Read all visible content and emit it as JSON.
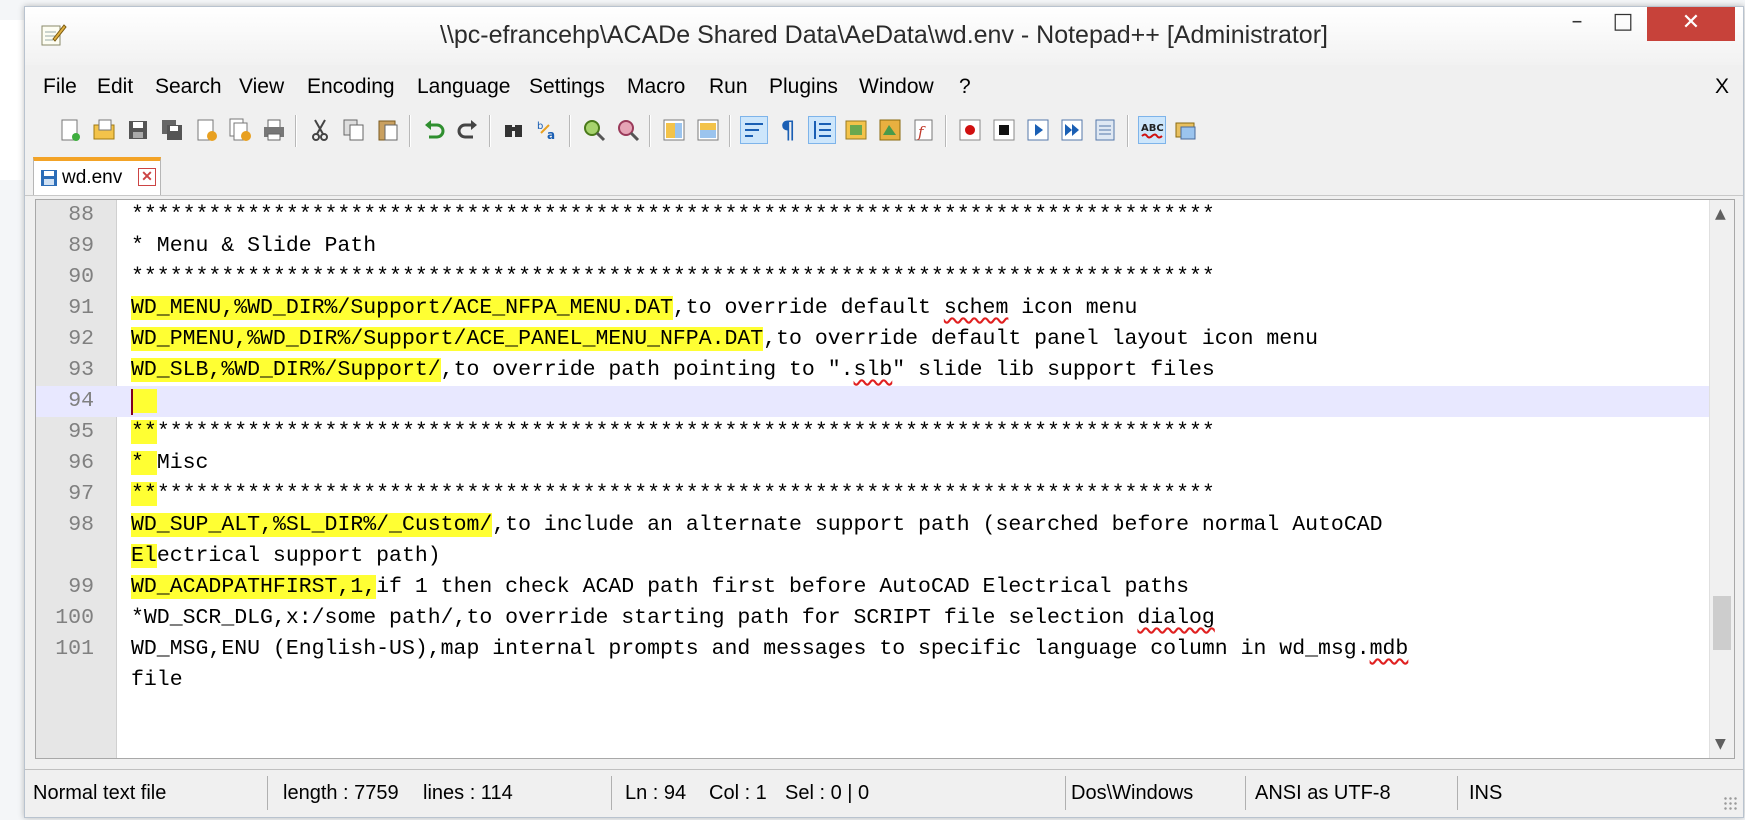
{
  "window": {
    "title": "\\\\pc-efrancehp\\ACADe Shared Data\\AeData\\wd.env - Notepad++ [Administrator]",
    "minimize_glyph": "–",
    "maximize_glyph": "□",
    "close_glyph": "✕",
    "close_color": "#c7423a"
  },
  "menu": {
    "items": [
      "File",
      "Edit",
      "Search",
      "View",
      "Encoding",
      "Language",
      "Settings",
      "Macro",
      "Run",
      "Plugins",
      "Window",
      "?"
    ],
    "close_doc": "X"
  },
  "toolbar": {
    "icons": [
      "new-file-icon",
      "open-file-icon",
      "save-icon",
      "save-all-icon",
      "close-icon",
      "close-all-icon",
      "print-icon",
      "cut-icon",
      "copy-icon",
      "paste-icon",
      "undo-icon",
      "redo-icon",
      "find-icon",
      "replace-icon",
      "zoom-in-icon",
      "zoom-out-icon",
      "sync-vertical-icon",
      "sync-horizontal-icon",
      "word-wrap-icon",
      "show-all-chars-icon",
      "indent-guide-icon",
      "user-lang-icon",
      "doc-map-icon",
      "function-list-icon",
      "record-macro-icon",
      "stop-record-icon",
      "play-macro-icon",
      "run-macro-multiple-icon",
      "save-macro-icon",
      "spell-check-icon",
      "spell-settings-icon"
    ],
    "pilcrow": "¶"
  },
  "tab": {
    "label": "wd.env",
    "close": "✕",
    "accent": "#f3a326"
  },
  "editor": {
    "highlight_color": "#ffff33",
    "current_line": "94",
    "lines": [
      {
        "num": "88",
        "parts": [
          {
            "t": "************************************************************************************"
          }
        ]
      },
      {
        "num": "89",
        "parts": [
          {
            "t": "* Menu & Slide Path"
          }
        ]
      },
      {
        "num": "90",
        "parts": [
          {
            "t": "************************************************************************************"
          }
        ]
      },
      {
        "num": "91",
        "parts": [
          {
            "t": "WD_MENU,",
            "hl": true
          },
          {
            "t": "%WD_DIR%/Support/ACE_NFPA_MENU.DAT",
            "hl": true
          },
          {
            "t": ",to override default "
          },
          {
            "t": "schem",
            "spell": true
          },
          {
            "t": " icon menu"
          }
        ]
      },
      {
        "num": "92",
        "parts": [
          {
            "t": "WD_PMENU,",
            "hl": true
          },
          {
            "t": "%WD_DIR%/Support/ACE_PANEL_MENU_NFPA.DAT",
            "hl": true
          },
          {
            "t": ",to override default panel layout icon menu"
          }
        ]
      },
      {
        "num": "93",
        "parts": [
          {
            "t": "WD_SLB,",
            "hl": true
          },
          {
            "t": "%WD_DIR%/Support/",
            "hl": true
          },
          {
            "t": ",to override path pointing to \"."
          },
          {
            "t": "slb",
            "spell": true
          },
          {
            "t": "\" slide lib support files"
          }
        ]
      },
      {
        "num": "94",
        "parts": [
          {
            "t": "  ",
            "hl": true
          }
        ]
      },
      {
        "num": "95",
        "parts": [
          {
            "t": "**",
            "hl": true
          },
          {
            "t": "**********************************************************************************"
          }
        ]
      },
      {
        "num": "96",
        "parts": [
          {
            "t": "* ",
            "hl": true
          },
          {
            "t": "Misc"
          }
        ]
      },
      {
        "num": "97",
        "parts": [
          {
            "t": "**",
            "hl": true
          },
          {
            "t": "**********************************************************************************"
          }
        ]
      },
      {
        "num": "98",
        "parts": [
          {
            "t": "WD_SUP_ALT,",
            "hl": true
          },
          {
            "t": "%SL_DIR%/_Custom/",
            "hl": true
          },
          {
            "t": ",to include an alternate support path (searched before normal AutoCAD"
          }
        ]
      },
      {
        "num": "",
        "parts": [
          {
            "t": "El",
            "hl": true
          },
          {
            "t": "ectrical support path)"
          }
        ]
      },
      {
        "num": "99",
        "parts": [
          {
            "t": "WD_ACADPATHFIRST,",
            "hl": true
          },
          {
            "t": "1,",
            "hl": true
          },
          {
            "t": "if 1 then check ACAD path first before AutoCAD Electrical paths"
          }
        ]
      },
      {
        "num": "100",
        "parts": [
          {
            "t": "*WD_SCR_DLG,x:/some path/,to override starting path for SCRIPT file selection "
          },
          {
            "t": "dialog",
            "spell": true
          }
        ]
      },
      {
        "num": "101",
        "parts": [
          {
            "t": "WD_MSG,ENU (English-US),map internal prompts and messages to specific language column in wd_msg."
          },
          {
            "t": "mdb",
            "spell": true
          }
        ]
      },
      {
        "num": "",
        "parts": [
          {
            "t": "file"
          }
        ]
      }
    ]
  },
  "status": {
    "file_type": "Normal text file",
    "length": "length : 7759",
    "lines": "lines : 114",
    "ln": "Ln : 94",
    "col": "Col : 1",
    "sel": "Sel : 0 | 0",
    "eol": "Dos\\Windows",
    "encoding": "ANSI as UTF-8",
    "mode": "INS"
  }
}
